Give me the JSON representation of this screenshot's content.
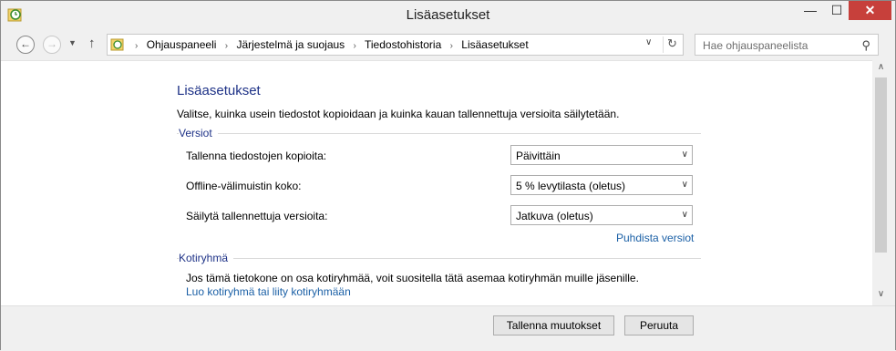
{
  "window": {
    "title": "Lisäasetukset",
    "minimize_glyph": "—",
    "maximize_glyph": "☐",
    "close_glyph": "✕"
  },
  "nav": {
    "back_glyph": "←",
    "forward_glyph": "→",
    "recent_glyph": "▼",
    "up_glyph": "↑",
    "breadcrumbs": [
      "Ohjauspaneeli",
      "Järjestelmä ja suojaus",
      "Tiedostohistoria",
      "Lisäasetukset"
    ],
    "separator_glyph": "›",
    "dropdown_glyph": "∨",
    "refresh_glyph": "↻"
  },
  "search": {
    "placeholder": "Hae ohjauspaneelista",
    "icon_glyph": "⚲"
  },
  "main": {
    "heading": "Lisäasetukset",
    "intro": "Valitse, kuinka usein tiedostot kopioidaan ja kuinka kauan tallennettuja versioita säilytetään.",
    "versions_group": {
      "label": "Versiot",
      "rows": [
        {
          "label": "Tallenna tiedostojen kopioita:",
          "value": "Päivittäin"
        },
        {
          "label": "Offline-välimuistin koko:",
          "value": "5 % levytilasta (oletus)"
        },
        {
          "label": "Säilytä tallennettuja versioita:",
          "value": "Jatkuva (oletus)"
        }
      ],
      "cleanup_link": "Puhdista versiot"
    },
    "homegroup": {
      "label": "Kotiryhmä",
      "text": "Jos tämä tietokone on osa kotiryhmää, voit suositella tätä asemaa kotiryhmän muille jäsenille.",
      "link": "Luo kotiryhmä tai liity kotiryhmään"
    }
  },
  "select_arrow_glyph": "∨",
  "scrollbar": {
    "up_glyph": "∧",
    "down_glyph": "∨"
  },
  "footer": {
    "save_label": "Tallenna muutokset",
    "cancel_label": "Peruuta"
  },
  "colors": {
    "heading": "#1e3287",
    "link": "#1b60a6",
    "close_button": "#c7403b"
  }
}
